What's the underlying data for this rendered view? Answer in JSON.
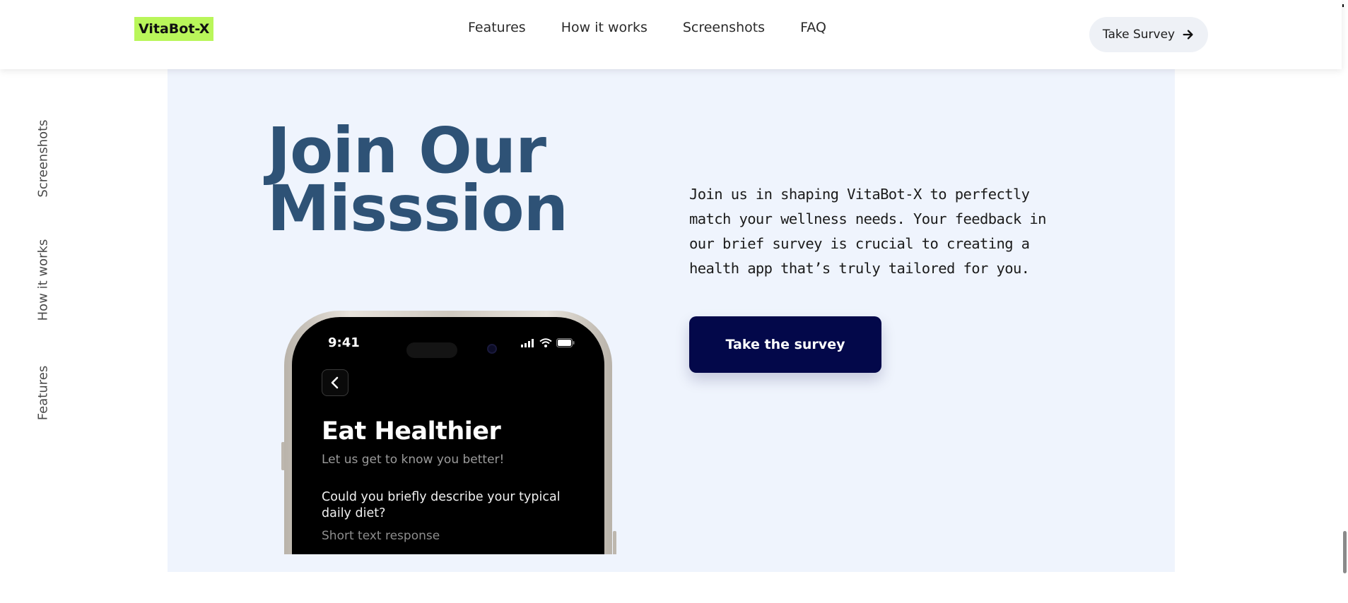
{
  "header": {
    "logo": "VitaBot-X",
    "nav": [
      "Features",
      "How it works",
      "Screenshots",
      "FAQ"
    ],
    "cta_label": "Take Survey",
    "cta_icon": "arrow-right-icon"
  },
  "side_nav": {
    "items": [
      "Screenshots",
      "How it works",
      "Features"
    ]
  },
  "main": {
    "title_line1": "Join Our",
    "title_line2": "Misssion",
    "description": "Join us in shaping VitaBot-X to perfectly match your wellness needs. Your feedback in our brief survey is crucial to creating a health app that’s truly tailored for you.",
    "button_label": "Take the survey"
  },
  "phone": {
    "time": "9:41",
    "title": "Eat Healthier",
    "subtitle": "Let us get to know you better!",
    "question": "Could you briefly describe your typical daily diet?",
    "answer_placeholder": "Short text response"
  },
  "colors": {
    "logo_bg": "#b9f65a",
    "title": "#2e5276",
    "section_bg": "#eff4fd",
    "button_bg": "#03084a",
    "cta_bg": "#eef1f6"
  }
}
